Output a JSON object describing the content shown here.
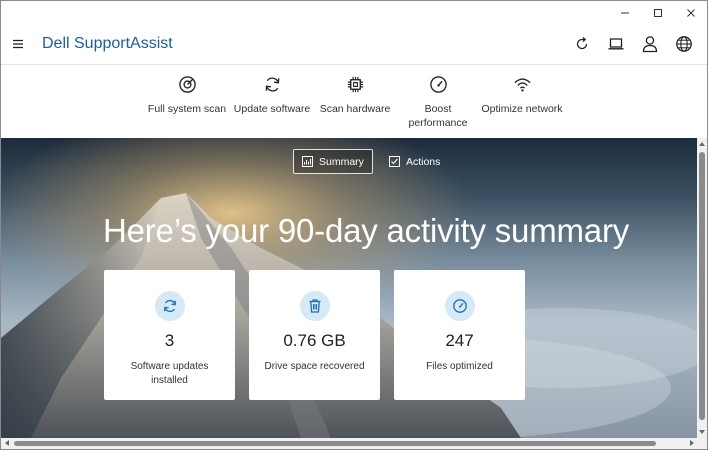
{
  "app": {
    "title": "Dell SupportAssist"
  },
  "window_controls": [
    "minimize-icon",
    "maximize-icon",
    "close-icon"
  ],
  "header_icons": [
    "refresh-icon",
    "laptop-icon",
    "user-icon",
    "globe-icon"
  ],
  "toolbar": {
    "items": [
      {
        "icon": "scan-icon",
        "label": "Full system scan"
      },
      {
        "icon": "update-icon",
        "label": "Update software"
      },
      {
        "icon": "chip-icon",
        "label": "Scan hardware"
      },
      {
        "icon": "gauge-icon",
        "label": "Boost performance"
      },
      {
        "icon": "wifi-icon",
        "label": "Optimize network"
      }
    ]
  },
  "tabs": {
    "summary": "Summary",
    "actions": "Actions",
    "active": "summary"
  },
  "hero": {
    "headline": "Here’s your 90-day activity summary"
  },
  "cards": [
    {
      "icon": "update-icon",
      "value": "3",
      "label": "Software updates installed"
    },
    {
      "icon": "trash-icon",
      "value": "0.76 GB",
      "label": "Drive space recovered"
    },
    {
      "icon": "gauge-icon",
      "value": "247",
      "label": "Files optimized"
    }
  ],
  "colors": {
    "brand": "#1a5fa8",
    "icon_accent": "#1a6fb8",
    "card_icon_bg": "#d6e9f7"
  }
}
